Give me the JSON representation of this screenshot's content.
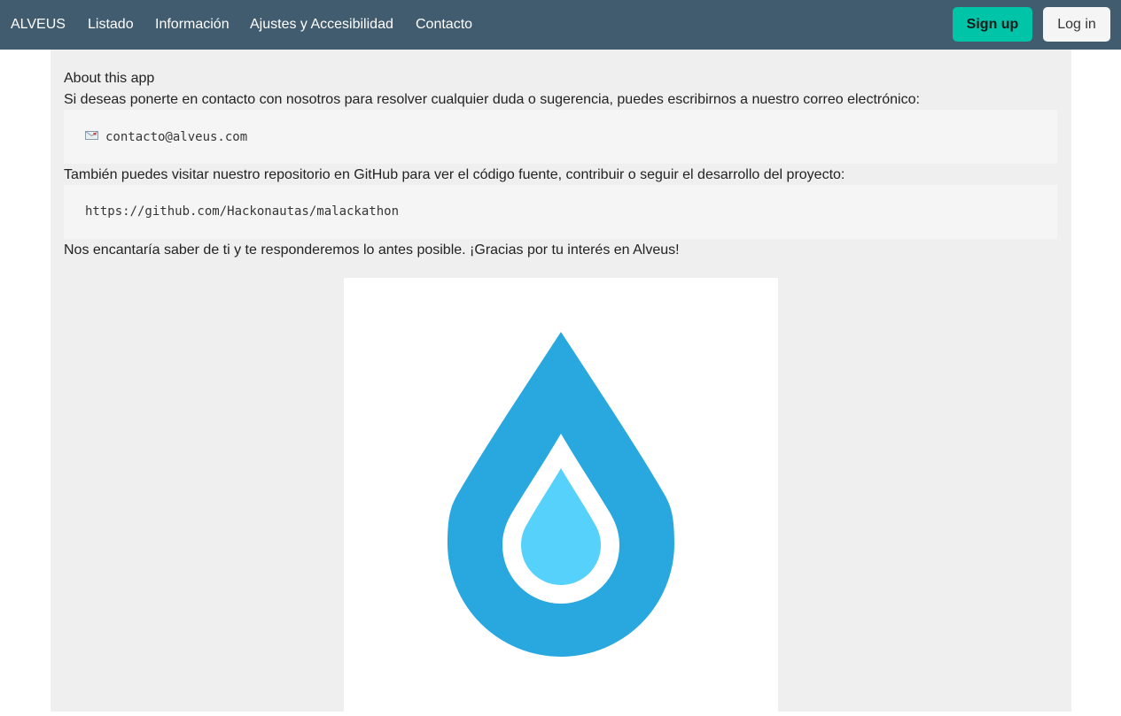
{
  "nav": {
    "brand": "ALVEUS",
    "links": [
      "Listado",
      "Información",
      "Ajustes y Accesibilidad",
      "Contacto"
    ],
    "signup_label": "Sign up",
    "login_label": "Log in"
  },
  "main": {
    "heading": "About this app",
    "intro": "Si deseas ponerte en contacto con nosotros para resolver cualquier duda o sugerencia, puedes escribirnos a nuestro correo electrónico:",
    "email": "contacto@alveus.com",
    "github_intro": "También puedes visitar nuestro repositorio en GitHub para ver el código fuente, contribuir o seguir el desarrollo del proyecto:",
    "github_url": "https://github.com/Hackonautas/malackathon",
    "closing": "Nos encantaría saber de ti y te responderemos lo antes posible. ¡Gracias por tu interés en Alveus!"
  },
  "icons": {
    "email": "envelope-icon",
    "logo": "water-drop-logo"
  },
  "colors": {
    "navbar": "#415b6f",
    "signup": "#00c4a7",
    "drop_outer": "#29a8e0",
    "drop_inner": "#56d1fb",
    "content_bg": "#efefef"
  }
}
